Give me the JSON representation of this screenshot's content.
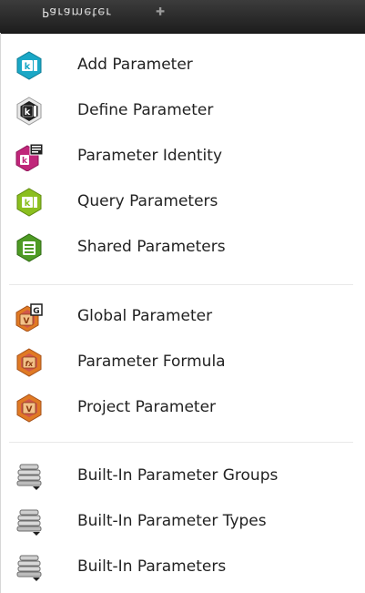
{
  "header": {
    "title": "Parameter"
  },
  "groups": [
    {
      "items": [
        {
          "label": "Add Parameter"
        },
        {
          "label": "Define Parameter"
        },
        {
          "label": "Parameter Identity"
        },
        {
          "label": "Query Parameters"
        },
        {
          "label": "Shared Parameters"
        }
      ]
    },
    {
      "items": [
        {
          "label": "Global Parameter"
        },
        {
          "label": "Parameter Formula"
        },
        {
          "label": "Project Parameter"
        }
      ]
    },
    {
      "items": [
        {
          "label": "Built-In Parameter Groups"
        },
        {
          "label": "Built-In Parameter Types"
        },
        {
          "label": "Built-In Parameters"
        }
      ]
    }
  ],
  "colors": {
    "teal": "#1aa7c6",
    "black": "#1e1e1e",
    "magenta": "#c0267a",
    "green": "#8bbf1f",
    "darkgreen": "#4e9b24",
    "orange": "#e07a24",
    "grey": "#6d6d6d"
  },
  "icons": [
    "add-parameter-icon",
    "define-parameter-icon",
    "parameter-identity-icon",
    "query-parameters-icon",
    "shared-parameters-icon",
    "global-parameter-icon",
    "parameter-formula-icon",
    "project-parameter-icon",
    "builtin-parameter-groups-icon",
    "builtin-parameter-types-icon",
    "builtin-parameters-icon"
  ]
}
